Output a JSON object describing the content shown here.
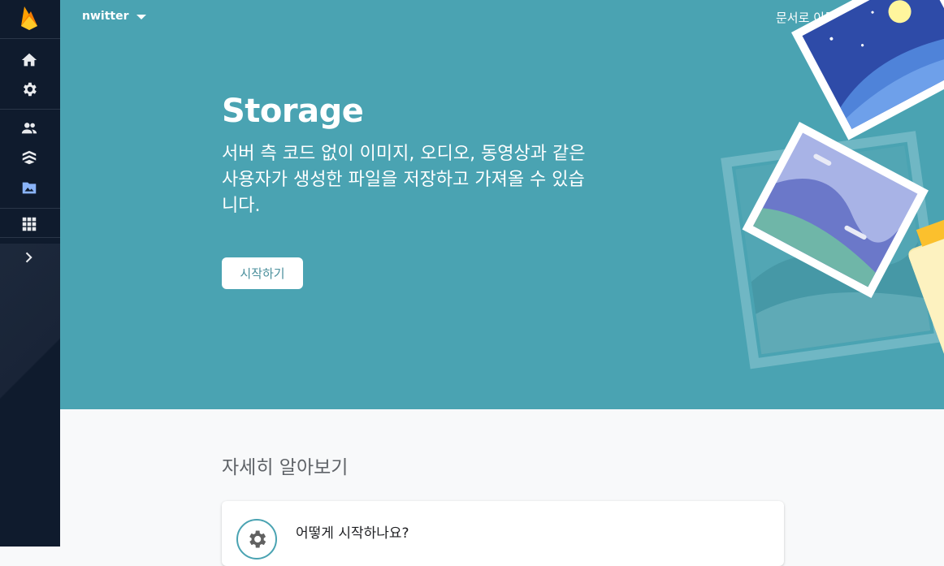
{
  "sidebar": {
    "icons": [
      "firebase-logo",
      "home-icon",
      "settings-icon",
      "users-icon",
      "firestore-icon",
      "storage-icon",
      "apps-grid-icon",
      "chevron-right-icon"
    ],
    "active": "storage-icon"
  },
  "header": {
    "project_name": "nwitter",
    "docs_link": "문서로 이동"
  },
  "hero": {
    "title": "Storage",
    "description": "서버 측 코드 없이 이미지, 오디오, 동영상과 같은 사용자가 생성한 파일을 저장하고 가져올 수 있습니다.",
    "start_button": "시작하기"
  },
  "learn_more": {
    "title": "자세히 알아보기",
    "card_label": "어떻게 시작하나요?"
  },
  "colors": {
    "hero_bg": "#4aa3b2",
    "sidebar_bg": "#0f1b2d",
    "active_icon": "#8ab4f8"
  }
}
